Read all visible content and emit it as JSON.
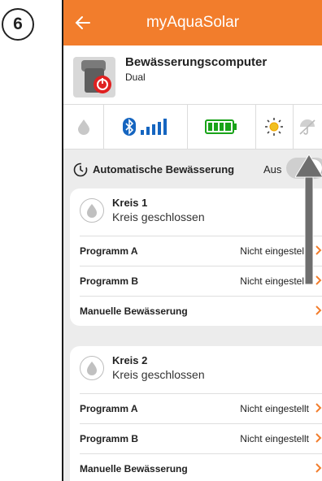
{
  "step_number": "6",
  "appbar": {
    "title": "myAquaSolar"
  },
  "device": {
    "name": "Bewässerungscomputer",
    "subtitle": "Dual"
  },
  "auto_watering": {
    "label": "Automatische Bewässerung",
    "state": "Aus"
  },
  "circuits": [
    {
      "name": "Kreis 1",
      "status": "Kreis geschlossen",
      "rows": [
        {
          "label": "Programm A",
          "value": "Nicht eingestellt"
        },
        {
          "label": "Programm B",
          "value": "Nicht eingestellt"
        },
        {
          "label": "Manuelle Bewässerung",
          "value": ""
        }
      ]
    },
    {
      "name": "Kreis 2",
      "status": "Kreis geschlossen",
      "rows": [
        {
          "label": "Programm A",
          "value": "Nicht eingestellt"
        },
        {
          "label": "Programm B",
          "value": "Nicht eingestellt"
        },
        {
          "label": "Manuelle Bewässerung",
          "value": ""
        }
      ]
    }
  ],
  "colors": {
    "accent": "#f27d2c",
    "bluetooth": "#1565c0",
    "battery": "#19a319",
    "sun": "#f0a500"
  },
  "icons": {
    "back": "arrow-left-icon",
    "rain": "raindrop-icon",
    "bluetooth": "bluetooth-icon",
    "signal": "signal-bars-icon",
    "battery": "battery-icon",
    "sun": "sun-icon",
    "umbrella": "umbrella-icon",
    "timer": "timer-icon",
    "chevron": "chevron-right-icon"
  }
}
